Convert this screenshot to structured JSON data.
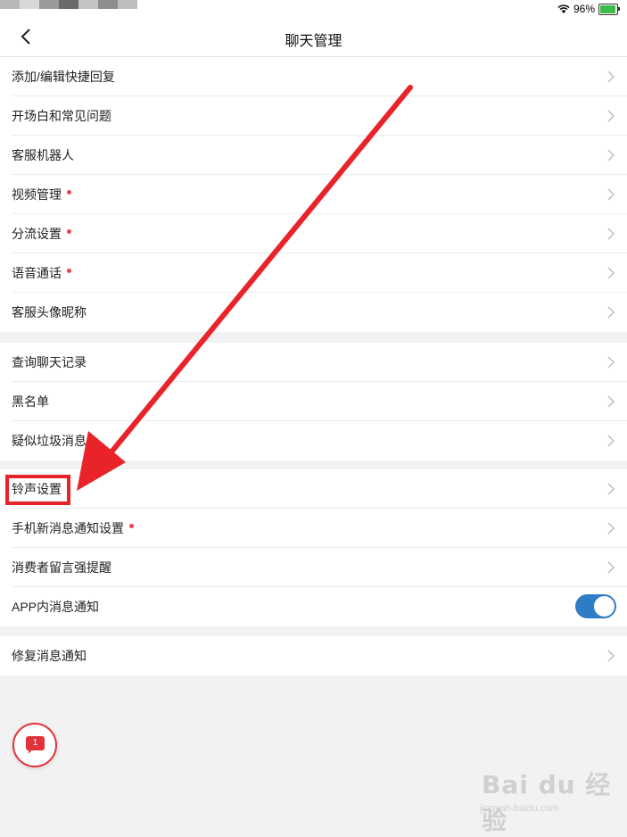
{
  "status_bar": {
    "battery_percent": "96%",
    "wifi_icon": "wifi-icon",
    "battery_icon": "battery-icon"
  },
  "nav": {
    "title": "聊天管理",
    "back_icon": "chevron-left-icon"
  },
  "group1": [
    {
      "label": "添加/编辑快捷回复",
      "dot": false
    },
    {
      "label": "开场白和常见问题",
      "dot": false
    },
    {
      "label": "客服机器人",
      "dot": false
    },
    {
      "label": "视频管理",
      "dot": true
    },
    {
      "label": "分流设置",
      "dot": true
    },
    {
      "label": "语音通话",
      "dot": true
    },
    {
      "label": "客服头像昵称",
      "dot": false
    }
  ],
  "group2": [
    {
      "label": "查询聊天记录",
      "dot": false
    },
    {
      "label": "黑名单",
      "dot": false
    },
    {
      "label": "疑似垃圾消息",
      "dot": false
    }
  ],
  "group3": [
    {
      "label": "铃声设置",
      "dot": false
    },
    {
      "label": "手机新消息通知设置",
      "dot": true
    },
    {
      "label": "消费者留言强提醒",
      "dot": false
    },
    {
      "label": "APP内消息通知",
      "dot": false,
      "toggle_on": true
    }
  ],
  "group4": [
    {
      "label": "修复消息通知",
      "dot": false
    }
  ],
  "fab": {
    "badge": "1",
    "icon": "chat-bubble-icon"
  },
  "annotation": {
    "color": "#e8232a"
  },
  "watermark": {
    "main": "Bai du 经验",
    "sub": "jingyan.baidu.com"
  },
  "colors": {
    "accent_toggle": "#2e7cc5",
    "dot_red": "#f0424a"
  }
}
